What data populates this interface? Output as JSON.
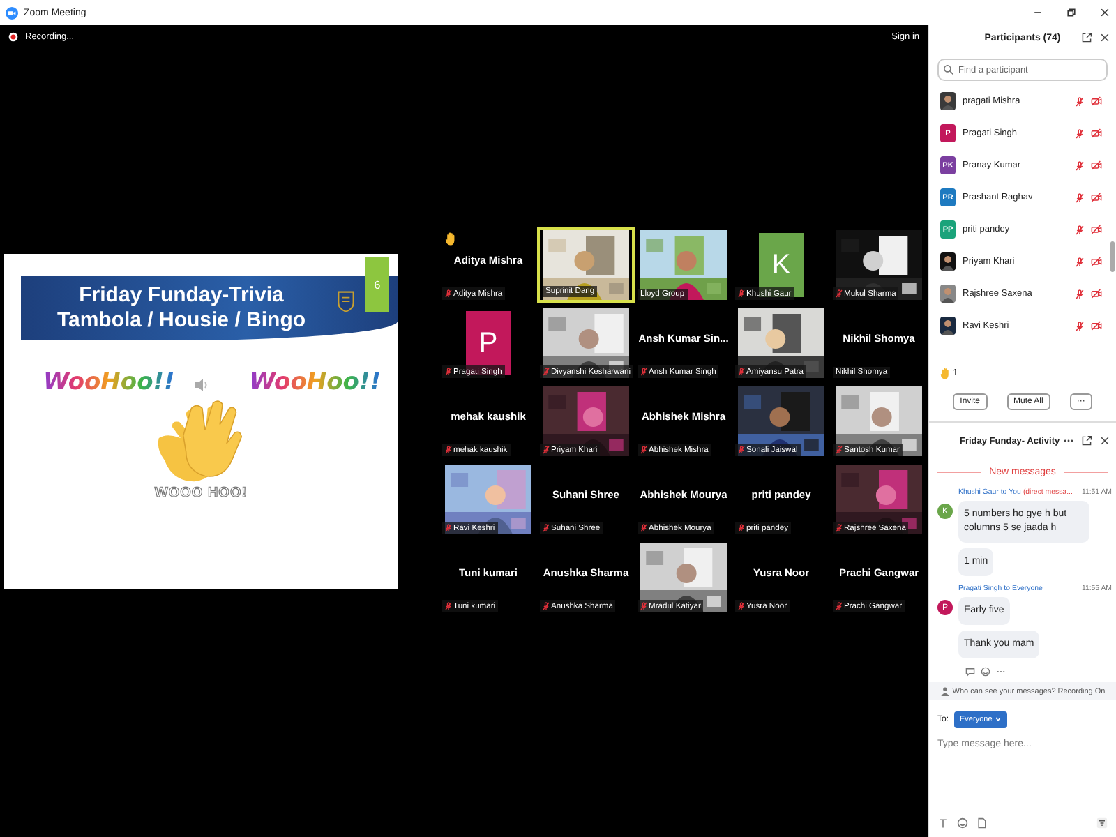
{
  "window": {
    "title": "Zoom Meeting"
  },
  "meeting": {
    "recording": "Recording...",
    "sign_in": "Sign in"
  },
  "slide": {
    "title_lines": [
      "Friday Funday-Trivia",
      "Tambola / Housie / Bingo"
    ],
    "number": "6",
    "stickers": [
      "WooHoo!!",
      "WooHoo!!"
    ],
    "caption": "WOOO HOO!"
  },
  "tiles": [
    {
      "kind": "name",
      "display": "Aditya Mishra",
      "label": "Aditya Mishra",
      "muted": true,
      "hand_raised": true,
      "selected": false
    },
    {
      "kind": "video",
      "label": "Suprinit Dang",
      "muted": false,
      "hand_raised": false,
      "selected": true
    },
    {
      "kind": "video",
      "label": "Lloyd Group",
      "muted": false,
      "hand_raised": false,
      "selected": false
    },
    {
      "kind": "avatar",
      "letter": "K",
      "color": "#6aa64a",
      "label": "Khushi Gaur",
      "muted": true,
      "hand_raised": false,
      "selected": false
    },
    {
      "kind": "video",
      "label": "Mukul Sharma",
      "muted": true,
      "hand_raised": false,
      "selected": false
    },
    {
      "kind": "avatar",
      "letter": "P",
      "color": "#c2185b",
      "label": "Pragati Singh",
      "muted": true,
      "hand_raised": false,
      "selected": false
    },
    {
      "kind": "video",
      "label": "Divyanshi Kesharwani",
      "muted": true,
      "hand_raised": false,
      "selected": false
    },
    {
      "kind": "name",
      "display": "Ansh Kumar Sin...",
      "label": "Ansh Kumar Singh",
      "muted": true,
      "hand_raised": false,
      "selected": false
    },
    {
      "kind": "video",
      "label": "Amiyansu Patra",
      "muted": true,
      "hand_raised": false,
      "selected": false
    },
    {
      "kind": "name",
      "display": "Nikhil Shomya",
      "label": "Nikhil Shomya",
      "muted": false,
      "hand_raised": false,
      "selected": false
    },
    {
      "kind": "name",
      "display": "mehak kaushik",
      "label": "mehak kaushik",
      "muted": true,
      "hand_raised": false,
      "selected": false
    },
    {
      "kind": "video",
      "label": "Priyam Khari",
      "muted": true,
      "hand_raised": false,
      "selected": false
    },
    {
      "kind": "name",
      "display": "Abhishek Mishra",
      "label": "Abhishek Mishra",
      "muted": true,
      "hand_raised": false,
      "selected": false
    },
    {
      "kind": "video",
      "label": "Sonali Jaiswal",
      "muted": true,
      "hand_raised": false,
      "selected": false
    },
    {
      "kind": "video",
      "label": "Santosh Kumar",
      "muted": true,
      "hand_raised": false,
      "selected": false
    },
    {
      "kind": "video",
      "label": "Ravi Keshri",
      "muted": true,
      "hand_raised": false,
      "selected": false
    },
    {
      "kind": "name",
      "display": "Suhani Shree",
      "label": "Suhani Shree",
      "muted": true,
      "hand_raised": false,
      "selected": false
    },
    {
      "kind": "name",
      "display": "Abhishek Mourya",
      "label": "Abhishek Mourya",
      "muted": true,
      "hand_raised": false,
      "selected": false
    },
    {
      "kind": "name",
      "display": "priti pandey",
      "label": "priti pandey",
      "muted": true,
      "hand_raised": false,
      "selected": false
    },
    {
      "kind": "video",
      "label": "Rajshree Saxena",
      "muted": true,
      "hand_raised": false,
      "selected": false
    },
    {
      "kind": "name",
      "display": "Tuni kumari",
      "label": "Tuni kumari",
      "muted": true,
      "hand_raised": false,
      "selected": false
    },
    {
      "kind": "name",
      "display": "Anushka Sharma",
      "label": "Anushka Sharma",
      "muted": true,
      "hand_raised": false,
      "selected": false
    },
    {
      "kind": "video",
      "label": "Mradul Katiyar",
      "muted": true,
      "hand_raised": false,
      "selected": false
    },
    {
      "kind": "name",
      "display": "Yusra Noor",
      "label": "Yusra Noor",
      "muted": true,
      "hand_raised": false,
      "selected": false
    },
    {
      "kind": "name",
      "display": "Prachi Gangwar",
      "label": "Prachi Gangwar",
      "muted": true,
      "hand_raised": false,
      "selected": false
    }
  ],
  "participants": {
    "title": "Participants (74)",
    "search": {
      "placeholder": "Find a participant"
    },
    "items": [
      {
        "name": "pragati Mishra"
      },
      {
        "name": "Pragati Singh",
        "avatar": {
          "kind": "initials",
          "text": "P",
          "color": "#c2185b"
        }
      },
      {
        "name": "Pranay Kumar",
        "avatar": {
          "kind": "initials",
          "text": "PK",
          "color": "#7b3fa0"
        }
      },
      {
        "name": "Prashant Raghav",
        "avatar": {
          "kind": "initials",
          "text": "PR",
          "color": "#1e7ac0"
        }
      },
      {
        "name": "priti pandey",
        "avatar": {
          "kind": "initials",
          "text": "PP",
          "color": "#1aa37a"
        }
      },
      {
        "name": "Priyam Khari"
      },
      {
        "name": "Rajshree Saxena"
      },
      {
        "name": "Ravi Keshri"
      }
    ],
    "raised_hands": "1",
    "buttons": [
      "Invite",
      "Mute All",
      "···"
    ]
  },
  "chat": {
    "title": "Friday Funday- Activity",
    "divider": "New messages",
    "messages": [
      {
        "sender": "Khushi Gaur",
        "to_word": "to",
        "recipient": "You",
        "note": "(direct messa...",
        "time": "11:51 AM",
        "avatar": {
          "text": "K",
          "color": "#6aa64a"
        },
        "bubbles": [
          "5 numbers ho gye h but columns 5 se jaada h",
          "1 min"
        ]
      },
      {
        "sender": "Pragati Singh",
        "to_word": "to",
        "recipient": "Everyone",
        "time": "11:55 AM",
        "avatar": {
          "text": "P",
          "color": "#c2185b"
        },
        "bubbles": [
          "Early five",
          "Thank you mam"
        ]
      }
    ],
    "privacy": "Who can see your messages? Recording On",
    "to_label": "To:",
    "to_value": "Everyone",
    "input": {
      "placeholder": "Type message here..."
    }
  }
}
